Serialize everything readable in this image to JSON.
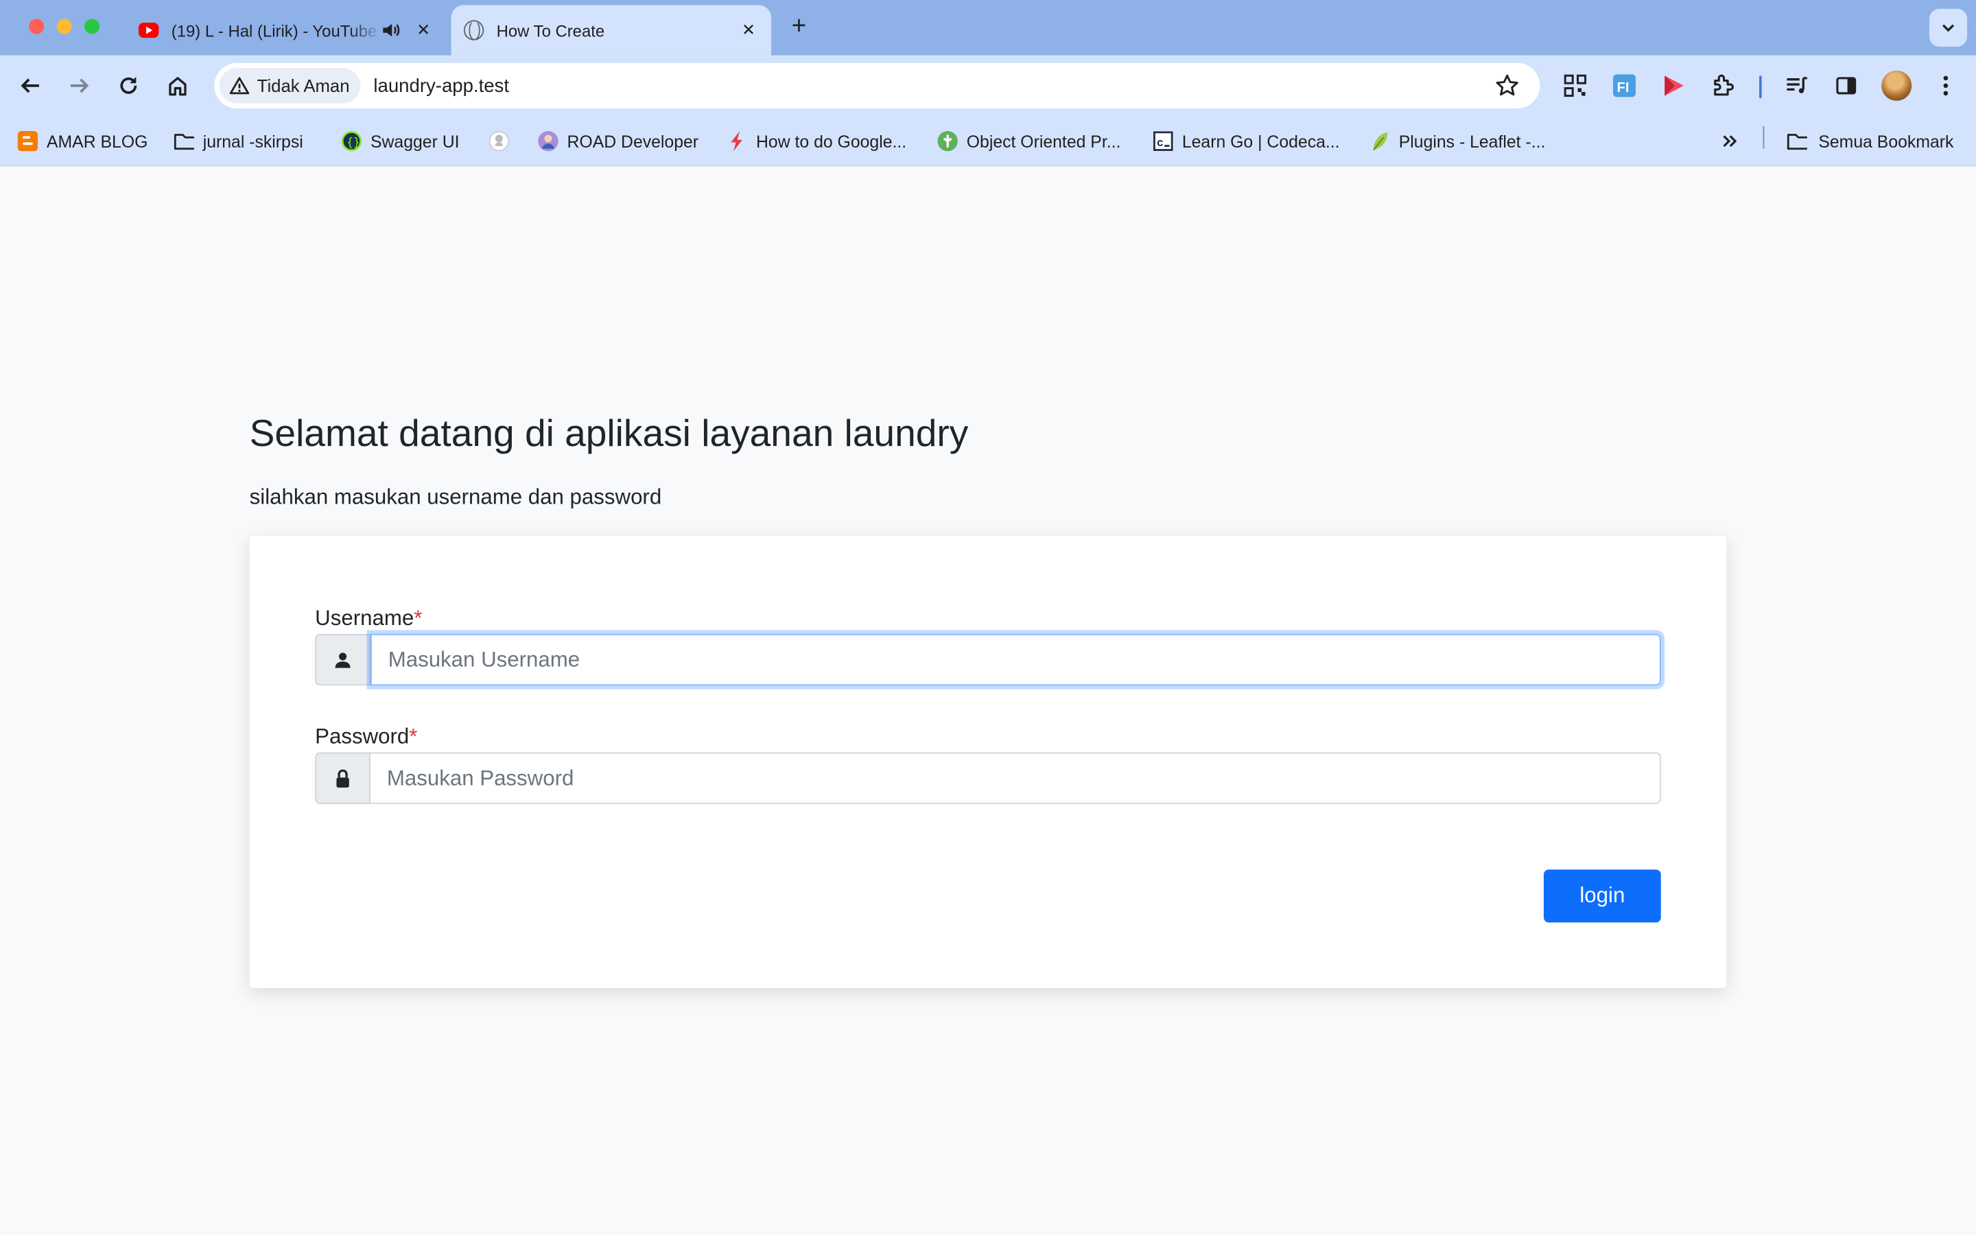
{
  "browser": {
    "tabs": [
      {
        "title": "(19) L - Hal (Lirik) - YouTube",
        "favicon": "youtube-icon",
        "playing_audio": true,
        "active": false
      },
      {
        "title": "How To Create",
        "favicon": "globe-icon",
        "active": true
      }
    ],
    "new_tab_icon": "plus-icon",
    "omnibox": {
      "security_chip": "Tidak Aman",
      "url": "laundry-app.test"
    },
    "bookmarks": [
      {
        "label": "AMAR BLOG",
        "icon": "blogger-icon"
      },
      {
        "label": "jurnal -skirpsi",
        "icon": "folder-icon"
      },
      {
        "label": "Swagger UI",
        "icon": "swagger-icon"
      },
      {
        "label": "",
        "icon": "github-icon"
      },
      {
        "label": "ROAD Developer",
        "icon": "road-developer-icon"
      },
      {
        "label": "How to do Google...",
        "icon": "bolt-icon"
      },
      {
        "label": "Object Oriented Pr...",
        "icon": "treehouse-icon"
      },
      {
        "label": "Learn Go | Codeca...",
        "icon": "codecademy-icon"
      },
      {
        "label": "Plugins - Leaflet -...",
        "icon": "leaflet-icon"
      }
    ],
    "all_bookmarks": "Semua Bookmark"
  },
  "page": {
    "heading": "Selamat datang di aplikasi layanan laundry",
    "subheading": "silahkan masukan username dan password",
    "form": {
      "username_label": "Username",
      "username_placeholder": "Masukan Username",
      "username_value": "",
      "password_label": "Password",
      "password_placeholder": "Masukan Password",
      "password_value": "",
      "required_marker": "*",
      "login_label": "login"
    }
  },
  "colors": {
    "tabstrip": "#8eb1e8",
    "toolbar": "#d3e3fd",
    "primary": "#0d6efd",
    "required": "#dc3545",
    "page_bg": "#f8f9fa"
  }
}
